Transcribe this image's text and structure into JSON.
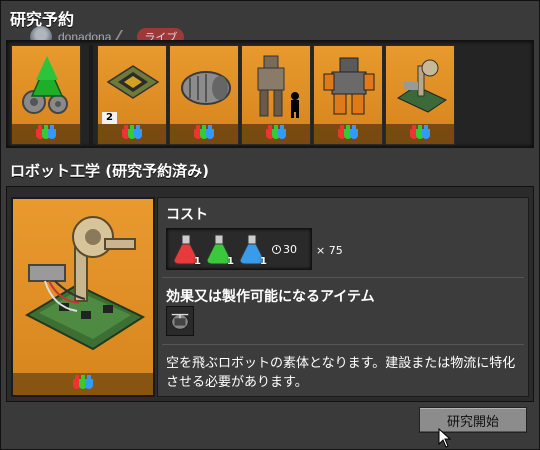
{
  "queue_title": "研究予約",
  "overlay": {
    "username": "donadona",
    "live_label": "ライブ"
  },
  "queue": [
    {
      "name": "robotics-tech",
      "art": "gears-tree",
      "count": ""
    },
    {
      "name": "advanced-circuit",
      "art": "chip",
      "count": "2"
    },
    {
      "name": "electric-engine",
      "art": "motor",
      "count": ""
    },
    {
      "name": "exoskeleton",
      "art": "exo",
      "count": ""
    },
    {
      "name": "modular-armor",
      "art": "armor",
      "count": ""
    },
    {
      "name": "robotics",
      "art": "robot-frame",
      "count": ""
    }
  ],
  "section_title": "ロボット工学 (研究予約済み)",
  "detail": {
    "cost_heading": "コスト",
    "costs": [
      {
        "color": "#e83a3a",
        "count": "1",
        "icon": "red-science-pack-icon"
      },
      {
        "color": "#3cc83c",
        "count": "1",
        "icon": "green-science-pack-icon"
      },
      {
        "color": "#3a9be8",
        "count": "1",
        "icon": "blue-science-pack-icon"
      }
    ],
    "time": "30",
    "multiplier": "× 75",
    "unlock_heading": "効果又は製作可能になるアイテム",
    "unlock_item_icon": "flying-robot-frame-icon",
    "description": "空を飛ぶロボットの素体となります。建設または物流に特化させる必要があります。"
  },
  "start_button": "研究開始"
}
